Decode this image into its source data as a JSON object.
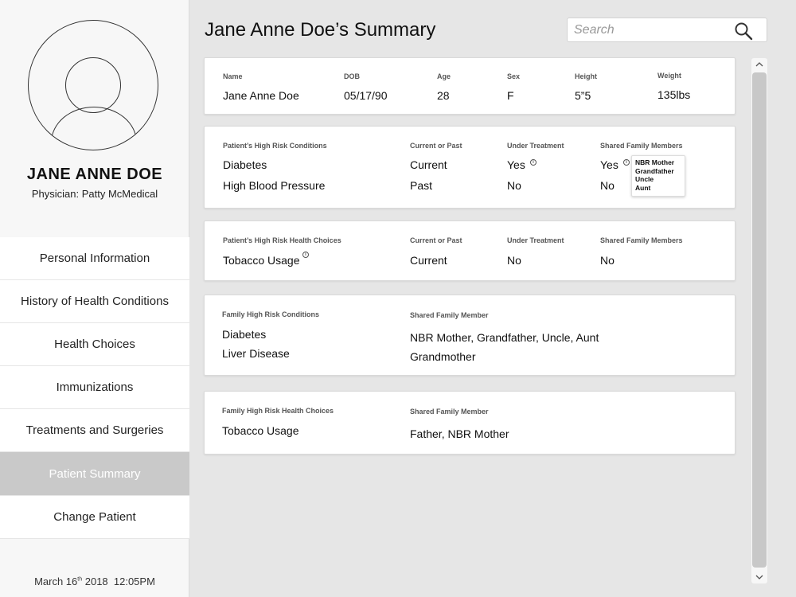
{
  "patient": {
    "name_upper": "JANE ANNE DOE",
    "physician": "Physician: Patty McMedical"
  },
  "nav": {
    "items": [
      {
        "label": "Personal Information"
      },
      {
        "label": "History of Health Conditions"
      },
      {
        "label": "Health Choices"
      },
      {
        "label": "Immunizations"
      },
      {
        "label": "Treatments and Surgeries"
      },
      {
        "label": "Patient Summary",
        "active": true
      },
      {
        "label": "Change Patient"
      }
    ]
  },
  "datetime": {
    "month_day": "March 16",
    "suffix": "th",
    "rest": " 2018  12:05PM"
  },
  "page": {
    "title": "Jane Anne Doe’s Summary"
  },
  "search": {
    "placeholder": "Search"
  },
  "summary": {
    "headers": {
      "name": "Name",
      "dob": "DOB",
      "age": "Age",
      "sex": "Sex",
      "height": "Height",
      "weight": "Weight"
    },
    "values": {
      "name": "Jane Anne Doe",
      "dob": "05/17/90",
      "age": "28",
      "sex": "F",
      "height": "5”5",
      "weight": "135lbs"
    }
  },
  "conditions": {
    "headers": {
      "title": "Patient’s High Risk Conditions",
      "current": "Current or Past",
      "treatment": "Under Treatment",
      "family": "Shared Family Members"
    },
    "rows": [
      {
        "condition": "Diabetes",
        "status": "Current",
        "treatment": "Yes",
        "family": "Yes"
      },
      {
        "condition": "High Blood Pressure",
        "status": "Past",
        "treatment": "No",
        "family": "No"
      }
    ],
    "tooltip": [
      "NBR Mother",
      "Grandfather",
      "Uncle",
      "Aunt"
    ]
  },
  "choices": {
    "headers": {
      "title": "Patient’s High Risk Health Choices",
      "current": "Current or Past",
      "treatment": "Under Treatment",
      "family": "Shared Family Members"
    },
    "rows": [
      {
        "choice": "Tobacco Usage",
        "status": "Current",
        "treatment": "No",
        "family": "No"
      }
    ]
  },
  "family_conditions": {
    "headers": {
      "title": "Family High Risk Conditions",
      "member": "Shared Family Member"
    },
    "conditions": [
      "Diabetes",
      "Liver Disease"
    ],
    "members": [
      "NBR Mother, Grandfather, Uncle, Aunt",
      "Grandmother"
    ]
  },
  "family_choices": {
    "headers": {
      "title": "Family High Risk Health Choices",
      "member": "Shared Family Member"
    },
    "choice": "Tobacco Usage",
    "members": "Father, NBR Mother"
  },
  "icons": {
    "search": "search-icon",
    "info": "info-icon",
    "scroll_up": "chevron-up-icon",
    "scroll_down": "chevron-down-icon",
    "avatar": "avatar-placeholder-icon"
  }
}
